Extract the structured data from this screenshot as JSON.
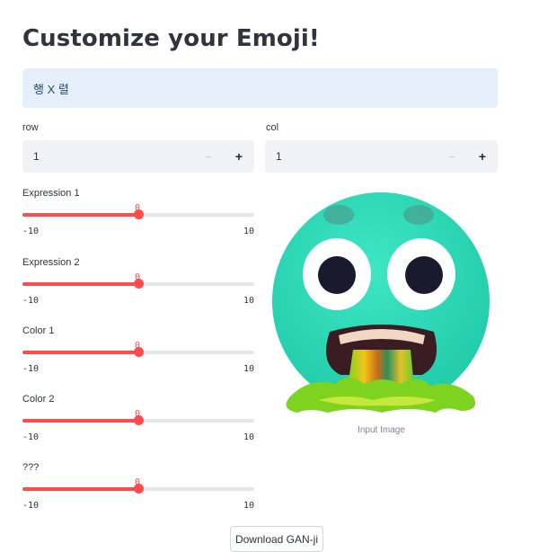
{
  "page": {
    "title": "Customize your Emoji!",
    "info_text": "행 X 렬"
  },
  "row_input": {
    "label": "row",
    "value": "1",
    "minus": "−",
    "plus": "+"
  },
  "col_input": {
    "label": "col",
    "value": "1",
    "minus": "−",
    "plus": "+"
  },
  "sliders": [
    {
      "label": "Expression 1",
      "value": 0,
      "min": -10,
      "max": 10,
      "value_text": "0",
      "min_text": "-10",
      "max_text": "10"
    },
    {
      "label": "Expression 2",
      "value": 0,
      "min": -10,
      "max": 10,
      "value_text": "0",
      "min_text": "-10",
      "max_text": "10"
    },
    {
      "label": "Color 1",
      "value": 0,
      "min": -10,
      "max": 10,
      "value_text": "0",
      "min_text": "-10",
      "max_text": "10"
    },
    {
      "label": "Color 2",
      "value": 0,
      "min": -10,
      "max": 10,
      "value_text": "0",
      "min_text": "-10",
      "max_text": "10"
    },
    {
      "label": "???",
      "value": 0,
      "min": -10,
      "max": 10,
      "value_text": "0",
      "min_text": "-10",
      "max_text": "10"
    }
  ],
  "image": {
    "caption": "Input Image",
    "icon": "vomiting-emoji-icon"
  },
  "download_button": {
    "label": "Download GAN-ji"
  },
  "colors": {
    "accent": "#ff4b4b",
    "info_background": "#e6eff9",
    "info_text": "#1e4f75",
    "input_background": "#f0f2f6",
    "emoji_face": "#2bdcbb"
  }
}
